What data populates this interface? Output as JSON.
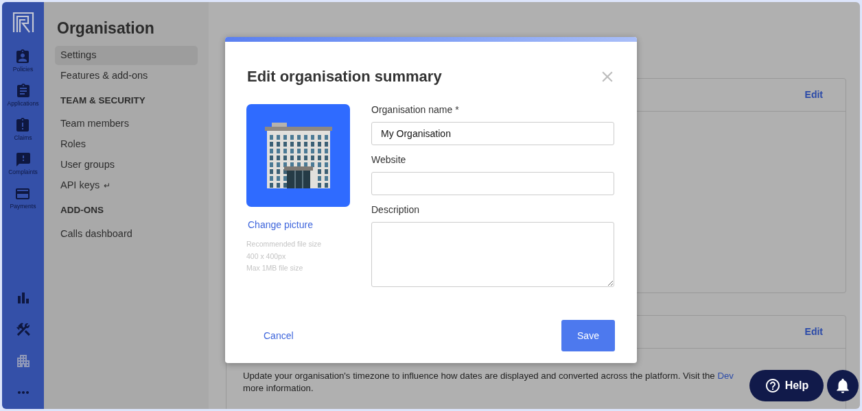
{
  "nav_rail": {
    "items": [
      {
        "label": "Policies",
        "kind": "policies"
      },
      {
        "label": "Applications",
        "kind": "applications"
      },
      {
        "label": "Claims",
        "kind": "claims"
      },
      {
        "label": "Complaints",
        "kind": "complaints"
      },
      {
        "label": "Payments",
        "kind": "payments"
      }
    ],
    "bottom_icons": [
      {
        "kind": "chart"
      },
      {
        "kind": "tools"
      },
      {
        "kind": "building"
      },
      {
        "kind": "more"
      }
    ]
  },
  "sidebar": {
    "title": "Organisation",
    "sections": [
      {
        "items": [
          {
            "label": "Settings",
            "selected": true
          },
          {
            "label": "Features & add-ons",
            "selected": false
          }
        ]
      },
      {
        "heading": "TEAM & SECURITY",
        "items": [
          {
            "label": "Team members",
            "selected": false
          },
          {
            "label": "Roles",
            "selected": false
          },
          {
            "label": "User groups",
            "selected": false
          },
          {
            "label": "API keys",
            "suffix": "↵",
            "selected": false
          }
        ]
      },
      {
        "heading": "ADD-ONS",
        "items": [
          {
            "label": "Calls dashboard",
            "selected": false
          }
        ]
      }
    ]
  },
  "cards": [
    {
      "action": "Edit"
    },
    {
      "action": "Edit",
      "description": "Update your organisation's timezone to influence how dates are displayed and converted across the platform. Visit the",
      "link": "Dev",
      "description_end": "more information."
    }
  ],
  "modal": {
    "title": "Edit organisation summary",
    "change_picture": "Change picture",
    "picture_hints": [
      "Recommended file size",
      "400 x 400px",
      "Max 1MB file size"
    ],
    "fields": [
      {
        "label": "Organisation name *",
        "value": "My Organisation",
        "kind": "text"
      },
      {
        "label": "Website",
        "kind": "text"
      },
      {
        "label": "Description",
        "kind": "textarea"
      }
    ],
    "cancel": "Cancel",
    "save": "Save"
  },
  "help_button": {
    "label": "Help"
  }
}
